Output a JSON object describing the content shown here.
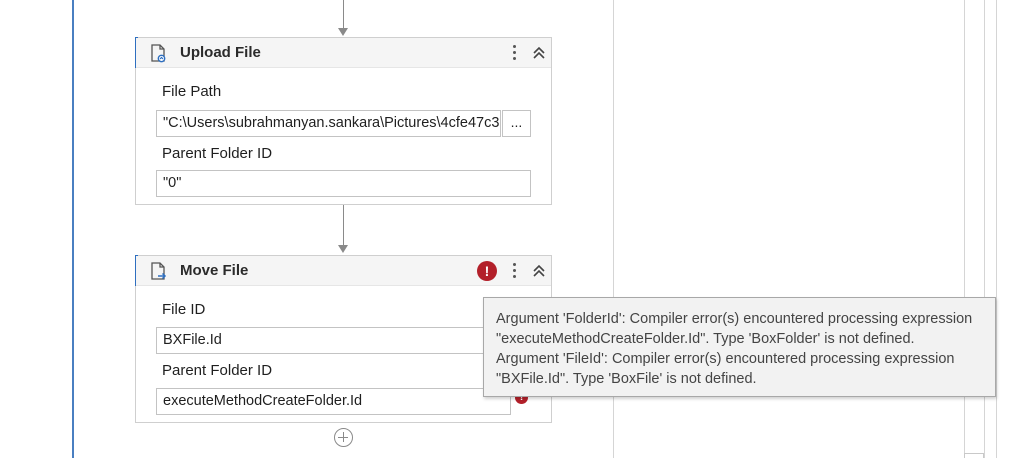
{
  "activities": {
    "upload": {
      "title": "Upload File",
      "fields": {
        "file_path_label": "File Path",
        "file_path_value": "\"C:\\Users\\subrahmanyan.sankara\\Pictures\\4cfe47c3",
        "browse_label": "...",
        "parent_folder_label": "Parent Folder ID",
        "parent_folder_value": "\"0\""
      }
    },
    "move": {
      "title": "Move File",
      "has_error": true,
      "error_icon": "!",
      "fields": {
        "file_id_label": "File ID",
        "file_id_value": "BXFile.Id",
        "parent_folder_label": "Parent Folder ID",
        "parent_folder_value": "executeMethodCreateFolder.Id"
      }
    }
  },
  "tooltip": {
    "lines": [
      "Argument 'FolderId': Compiler error(s) encountered processing expression",
      "\"executeMethodCreateFolder.Id\". Type 'BoxFolder' is not defined.",
      "Argument 'FileId': Compiler error(s) encountered processing expression",
      "\"BXFile.Id\". Type 'BoxFile' is not defined."
    ]
  },
  "icons": {
    "upload": "upload-file-icon",
    "move": "move-file-icon",
    "kebab": "more-options-icon",
    "collapse": "collapse-chevron-icon",
    "error": "error-icon",
    "add": "add-activity-icon"
  },
  "colors": {
    "accent": "#2e6fc0",
    "error": "#b3202a",
    "rail": "#4a7fc1"
  }
}
